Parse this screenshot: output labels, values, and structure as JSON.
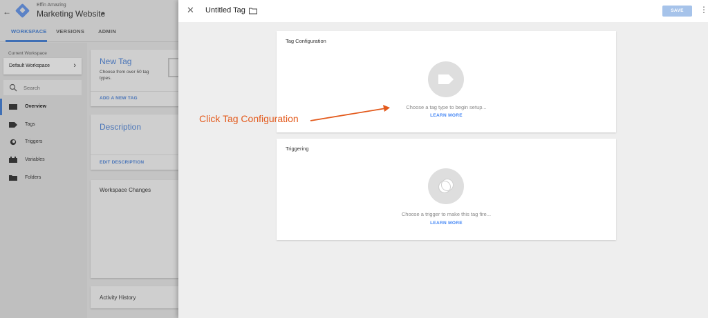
{
  "app": {
    "account_name": "Effin Amazing",
    "container_name": "Marketing Website",
    "nav_tabs": [
      "WORKSPACE",
      "VERSIONS",
      "ADMIN"
    ],
    "workspace_label": "Current Workspace",
    "workspace_value": "Default Workspace",
    "search_placeholder": "Search",
    "sidebar_items": [
      {
        "label": "Overview",
        "icon": "overview-icon"
      },
      {
        "label": "Tags",
        "icon": "tag-icon"
      },
      {
        "label": "Triggers",
        "icon": "trigger-icon"
      },
      {
        "label": "Variables",
        "icon": "variable-icon"
      },
      {
        "label": "Folders",
        "icon": "folder-icon"
      }
    ],
    "new_tag": {
      "title": "New Tag",
      "description": "Choose from over 50 tag types.",
      "link": "ADD A NEW TAG"
    },
    "description_card": {
      "title": "Description",
      "link": "EDIT DESCRIPTION"
    },
    "workspace_changes_title": "Workspace Changes",
    "activity_history_title": "Activity History"
  },
  "panel": {
    "title": "Untitled Tag",
    "save_label": "SAVE",
    "tag_configuration": {
      "title": "Tag Configuration",
      "hint": "Choose a tag type to begin setup...",
      "link": "LEARN MORE"
    },
    "triggering": {
      "title": "Triggering",
      "hint": "Choose a trigger to make this tag fire...",
      "link": "LEARN MORE"
    }
  },
  "annotation": {
    "text": "Click Tag Configuration",
    "color": "#e35a1c"
  },
  "colors": {
    "accent": "#4285f4",
    "save_button": "#a6c3ea"
  }
}
